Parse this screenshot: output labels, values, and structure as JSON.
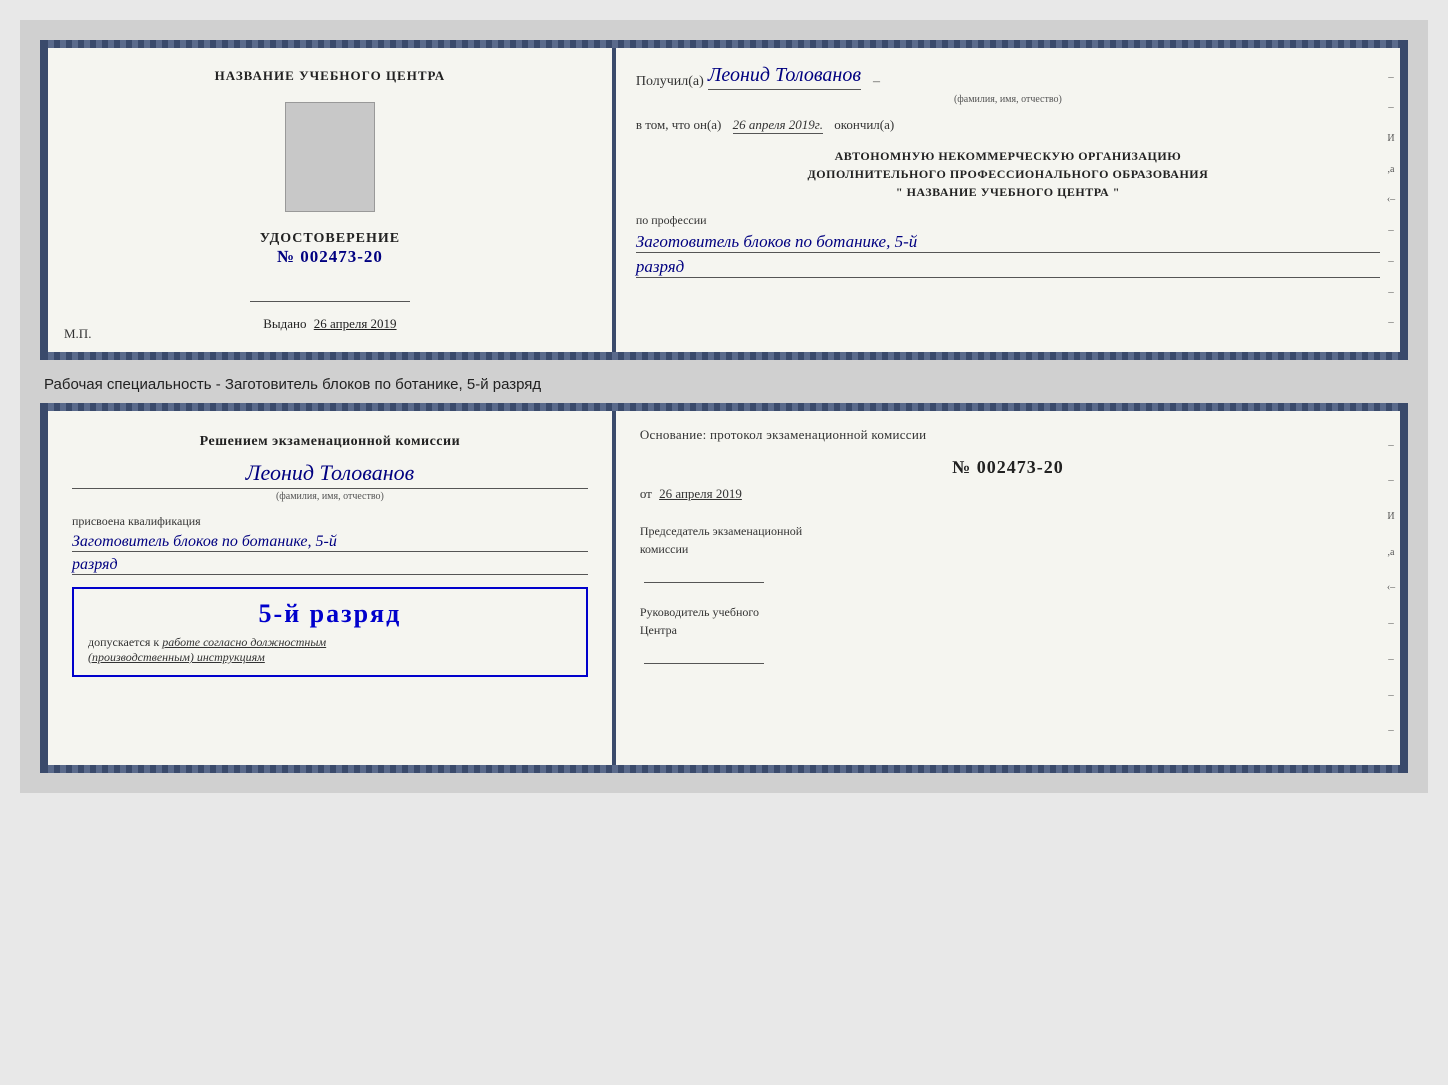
{
  "top_cert": {
    "left": {
      "title": "НАЗВАНИЕ УЧЕБНОГО ЦЕНТРА",
      "cert_label": "УДОСТОВЕРЕНИЕ",
      "cert_number": "№ 002473-20",
      "issued_label": "Выдано",
      "issued_date": "26 апреля 2019",
      "mp_label": "М.П."
    },
    "right": {
      "received_label": "Получил(а)",
      "recipient_name": "Леонид Толованов",
      "recipient_subtext": "(фамилия, имя, отчество)",
      "date_prefix": "в том, что он(а)",
      "date_value": "26 апреля 2019г.",
      "date_suffix": "окончил(а)",
      "org_line1": "АВТОНОМНУЮ НЕКОММЕРЧЕСКУЮ ОРГАНИЗАЦИЮ",
      "org_line2": "ДОПОЛНИТЕЛЬНОГО ПРОФЕССИОНАЛЬНОГО ОБРАЗОВАНИЯ",
      "org_line3": "\" НАЗВАНИЕ УЧЕБНОГО ЦЕНТРА \"",
      "profession_label": "по профессии",
      "profession_value": "Заготовитель блоков по ботанике, 5-й",
      "razryad_value": "разряд"
    }
  },
  "specialty_label": "Рабочая специальность - Заготовитель блоков по ботанике, 5-й разряд",
  "bottom_cert": {
    "left": {
      "decision_text": "Решением экзаменационной комиссии",
      "person_name": "Леонид Толованов",
      "person_subtext": "(фамилия, имя, отчество)",
      "qualification_label": "присвоена квалификация",
      "qualification_value": "Заготовитель блоков по ботанике, 5-й",
      "razryad_value": "разряд",
      "stamp_razryad": "5-й разряд",
      "dopusk_prefix": "допускается к",
      "dopusk_italic": "работе согласно должностным",
      "dopusk_italic2": "(производственным) инструкциям"
    },
    "right": {
      "osnov_label": "Основание: протокол экзаменационной комиссии",
      "protocol_number": "№ 002473-20",
      "ot_label": "от",
      "ot_date": "26 апреля 2019",
      "chairman_label": "Председатель экзаменационной",
      "chairman_label2": "комиссии",
      "head_label1": "Руководитель учебного",
      "head_label2": "Центра"
    }
  }
}
